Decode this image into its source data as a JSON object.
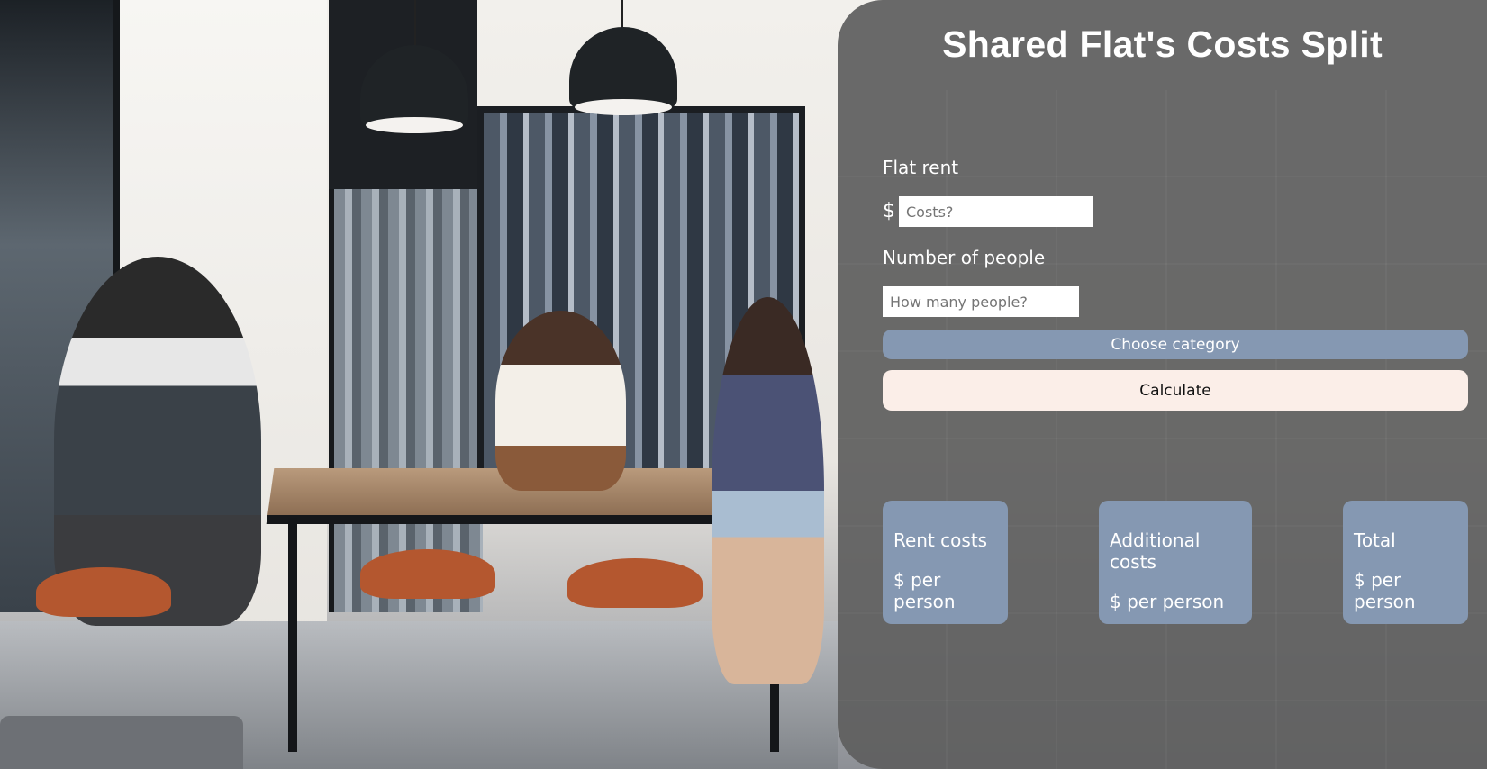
{
  "app": {
    "title": "Shared Flat's Costs Split"
  },
  "form": {
    "rent_label": "Flat rent",
    "currency_symbol": "$",
    "rent_placeholder": "Costs?",
    "people_label": "Number of people",
    "people_placeholder": "How many people?",
    "category_button": "Choose category",
    "calculate_button": "Calculate"
  },
  "results": [
    {
      "title": "Rent costs",
      "unit": "$ per person"
    },
    {
      "title": "Additional costs",
      "unit": "$ per person"
    },
    {
      "title": "Total",
      "unit": "$ per person"
    }
  ],
  "colors": {
    "panel": "#5f5f5f",
    "card": "#8598b2",
    "calculate_button": "#fbeee8",
    "text": "#ffffff"
  }
}
